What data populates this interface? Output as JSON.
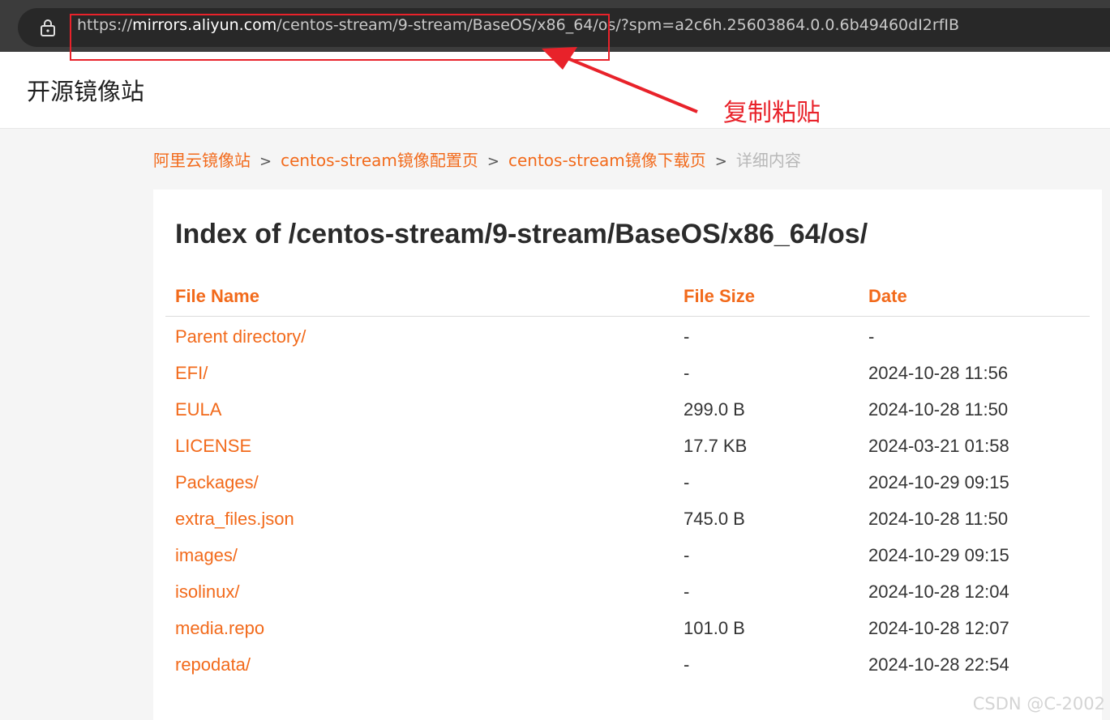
{
  "browser": {
    "url_scheme": "https://",
    "url_host": "mirrors.aliyun.com",
    "url_path": "/centos-stream/9-stream/BaseOS/x86_64/os/?spm=a2c6h.25603864.0.0.6b49460dI2rfIB",
    "lock_icon": "lock-icon"
  },
  "site": {
    "title": "开源镜像站"
  },
  "breadcrumb": {
    "items": [
      "阿里云镜像站",
      "centos-stream镜像配置页",
      "centos-stream镜像下载页"
    ],
    "separator": ">",
    "current": "详细内容"
  },
  "listing": {
    "heading": "Index of /centos-stream/9-stream/BaseOS/x86_64/os/",
    "columns": [
      "File Name",
      "File Size",
      "Date"
    ],
    "rows": [
      {
        "name": "Parent directory/",
        "size": "-",
        "date": "-"
      },
      {
        "name": "EFI/",
        "size": "-",
        "date": "2024-10-28 11:56"
      },
      {
        "name": "EULA",
        "size": "299.0 B",
        "date": "2024-10-28 11:50"
      },
      {
        "name": "LICENSE",
        "size": "17.7 KB",
        "date": "2024-03-21 01:58"
      },
      {
        "name": "Packages/",
        "size": "-",
        "date": "2024-10-29 09:15"
      },
      {
        "name": "extra_files.json",
        "size": "745.0 B",
        "date": "2024-10-28 11:50"
      },
      {
        "name": "images/",
        "size": "-",
        "date": "2024-10-29 09:15"
      },
      {
        "name": "isolinux/",
        "size": "-",
        "date": "2024-10-28 12:04"
      },
      {
        "name": "media.repo",
        "size": "101.0 B",
        "date": "2024-10-28 12:07"
      },
      {
        "name": "repodata/",
        "size": "-",
        "date": "2024-10-28 22:54"
      }
    ]
  },
  "annotation": {
    "text": "复制粘贴",
    "color": "#e8222a"
  },
  "watermark": "CSDN @C-2002",
  "colors": {
    "accent": "#f26a1b",
    "annotation": "#e8222a"
  }
}
